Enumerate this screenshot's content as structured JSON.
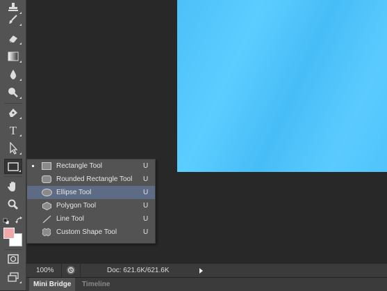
{
  "toolbar": {
    "tools": [
      {
        "name": "clone-stamp-tool",
        "icon": "stamp-icon"
      },
      {
        "name": "history-brush-tool",
        "icon": "history-brush-icon"
      },
      {
        "name": "eraser-tool",
        "icon": "eraser-icon"
      },
      {
        "name": "gradient-tool",
        "icon": "gradient-icon"
      },
      {
        "name": "blur-tool",
        "icon": "drop-icon"
      },
      {
        "name": "dodge-tool",
        "icon": "dodge-icon"
      },
      {
        "name": "pen-tool",
        "icon": "pen-icon"
      },
      {
        "name": "type-tool",
        "icon": "type-icon",
        "glyph": "T"
      },
      {
        "name": "path-selection-tool",
        "icon": "arrow-icon"
      },
      {
        "name": "rectangle-tool",
        "icon": "rectangle-icon",
        "active": true
      },
      {
        "name": "hand-tool",
        "icon": "hand-icon"
      },
      {
        "name": "zoom-tool",
        "icon": "magnifier-icon"
      }
    ],
    "foreground_color": "#f0a8ab",
    "background_color": "#ffffff"
  },
  "flyout": {
    "items": [
      {
        "label": "Rectangle Tool",
        "key": "U",
        "icon": "rectangle-shape-icon",
        "selected": true
      },
      {
        "label": "Rounded Rectangle Tool",
        "key": "U",
        "icon": "rounded-rectangle-icon"
      },
      {
        "label": "Ellipse Tool",
        "key": "U",
        "icon": "ellipse-icon",
        "highlighted": true
      },
      {
        "label": "Polygon Tool",
        "key": "U",
        "icon": "polygon-icon"
      },
      {
        "label": "Line Tool",
        "key": "U",
        "icon": "line-icon"
      },
      {
        "label": "Custom Shape Tool",
        "key": "U",
        "icon": "custom-shape-icon"
      }
    ]
  },
  "status": {
    "zoom": "100%",
    "doc_info": "Doc: 621.6K/621.6K"
  },
  "panel_tabs": [
    {
      "label": "Mini Bridge",
      "active": true
    },
    {
      "label": "Timeline",
      "active": false
    }
  ],
  "colors": {
    "canvas": "#55c6fd",
    "workspace": "#282828",
    "panel": "#535353",
    "highlight": "#5d6b84"
  }
}
